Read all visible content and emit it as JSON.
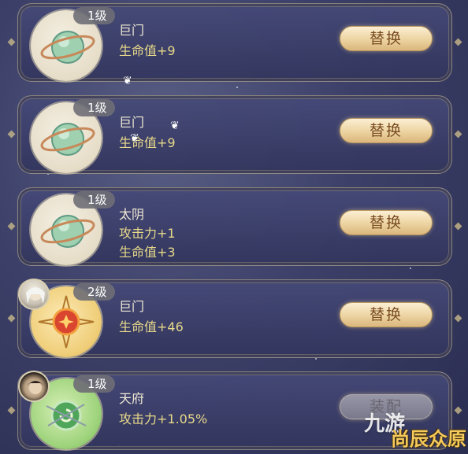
{
  "slots": [
    {
      "level": "1级",
      "name": "巨门",
      "stats": [
        "生命值+9"
      ],
      "button": "替换",
      "icon": "green-ring-orb-icon",
      "avatar": null
    },
    {
      "level": "1级",
      "name": "巨门",
      "stats": [
        "生命值+9"
      ],
      "button": "替换",
      "icon": "green-ring-orb-icon",
      "avatar": null
    },
    {
      "level": "1级",
      "name": "太阴",
      "stats": [
        "攻击力+1",
        "生命值+3"
      ],
      "button": "替换",
      "icon": "green-ring-orb-icon",
      "avatar": null
    },
    {
      "level": "2级",
      "name": "巨门",
      "stats": [
        "生命值+46"
      ],
      "button": "替换",
      "icon": "red-star-orb-icon",
      "avatar": "white-hair-character-avatar"
    },
    {
      "level": "1级",
      "name": "天府",
      "stats": [
        "攻击力+1.05%"
      ],
      "button": "装配",
      "icon": "green-spiral-orb-icon",
      "avatar": "dark-hair-character-avatar"
    }
  ],
  "watermark": {
    "brand": "九游",
    "corner": "尚辰众原"
  },
  "colors": {
    "stat_text": "#e8d98a",
    "button_text": "#7a4c22",
    "card_bg": "#464a78"
  }
}
